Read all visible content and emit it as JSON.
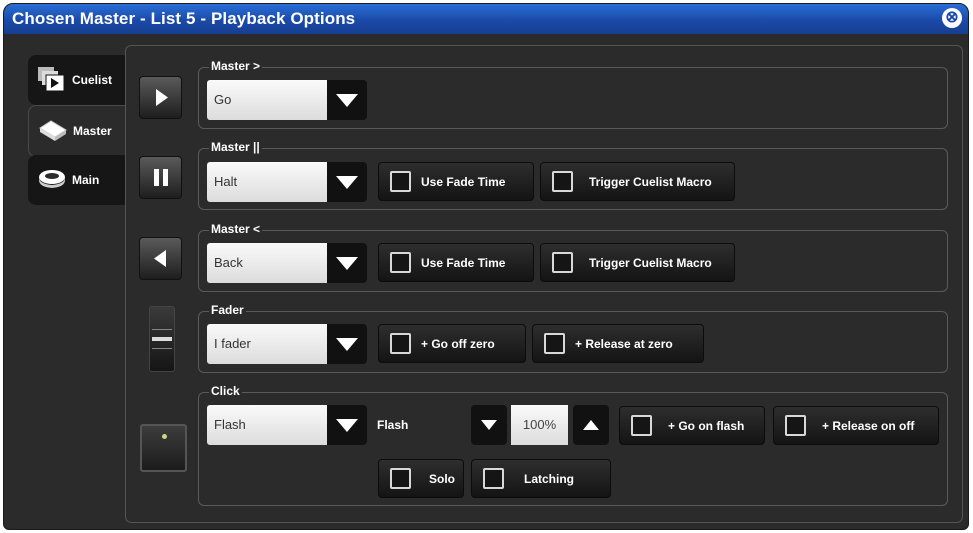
{
  "window": {
    "title": "Chosen Master - List 5 - Playback Options"
  },
  "tabs": [
    {
      "label": "Cuelist",
      "icon": "cuelist-icon"
    },
    {
      "label": "Master",
      "icon": "master-icon"
    },
    {
      "label": "Main",
      "icon": "main-icon"
    }
  ],
  "groups": {
    "go": {
      "label": "Master >",
      "value": "Go"
    },
    "halt": {
      "label": "Master ||",
      "value": "Halt",
      "use_fade_time": "Use Fade Time",
      "trigger_macro": "Trigger Cuelist Macro"
    },
    "back": {
      "label": "Master <",
      "value": "Back",
      "use_fade_time": "Use Fade Time",
      "trigger_macro": "Trigger Cuelist Macro"
    },
    "fader": {
      "label": "Fader",
      "value": "I fader",
      "go_off_zero": "+ Go off zero",
      "release_at_zero": "+ Release at zero"
    },
    "click": {
      "label": "Click",
      "value": "Flash",
      "flash_label": "Flash",
      "flash_level": "100%",
      "go_on_flash": "+ Go on flash",
      "release_on_off": "+ Release on off",
      "solo": "Solo",
      "latching": "Latching"
    }
  },
  "colors": {
    "titlebar": "#1a4aa8",
    "panel": "#2b2b2b"
  }
}
